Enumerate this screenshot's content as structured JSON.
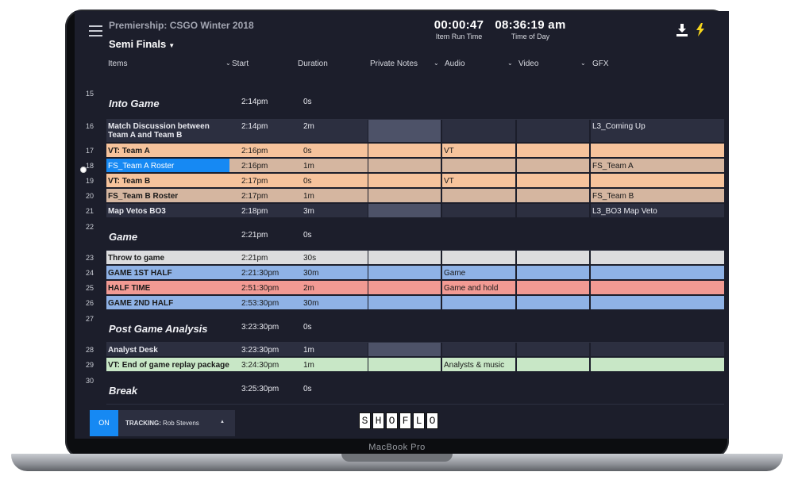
{
  "device_label": "MacBook Pro",
  "header": {
    "show_title": "Premiership: CSGO Winter 2018",
    "rundown_title": "Semi Finals",
    "item_run_time": "00:00:47",
    "item_run_time_label": "Item Run Time",
    "time_of_day": "08:36:19 am",
    "time_of_day_label": "Time of Day"
  },
  "columns": [
    "Items",
    "Start",
    "Duration",
    "Private Notes",
    "Audio",
    "Video",
    "GFX"
  ],
  "colors": {
    "bg": "#1c1e2b",
    "row_dark": "#2c2f40",
    "notes_dark": "#4d5268",
    "orange": "#f6c39c",
    "tan": "#d5b6a0",
    "grey": "#dcdcde",
    "blue": "#8fb2e6",
    "red": "#f29a93",
    "green": "#c8e7c6",
    "selected": "#1689f3"
  },
  "rows": [
    {
      "num": "15",
      "type": "header",
      "name": "Into Game",
      "start": "2:14pm",
      "duration": "0s"
    },
    {
      "num": "16",
      "type": "dark",
      "name": "Match Discussion between",
      "name2": "Team A and Team B",
      "start": "2:14pm",
      "duration": "2m",
      "notes": "",
      "audio": "",
      "video": "",
      "gfx": "L3_Coming Up"
    },
    {
      "num": "17",
      "type": "orange",
      "name": "VT: Team A",
      "start": "2:16pm",
      "duration": "0s",
      "notes": "",
      "audio": "VT",
      "video": "",
      "gfx": ""
    },
    {
      "num": "18",
      "type": "tan",
      "name": "FS_Team A Roster",
      "start": "2:16pm",
      "duration": "1m",
      "notes": "",
      "audio": "",
      "video": "",
      "gfx": "FS_Team A",
      "selected": true
    },
    {
      "num": "19",
      "type": "orange",
      "name": "VT: Team B",
      "start": "2:17pm",
      "duration": "0s",
      "notes": "",
      "audio": "VT",
      "video": "",
      "gfx": ""
    },
    {
      "num": "20",
      "type": "tan",
      "name": "FS_Team B Roster",
      "start": "2:17pm",
      "duration": "1m",
      "notes": "",
      "audio": "",
      "video": "",
      "gfx": "FS_Team B"
    },
    {
      "num": "21",
      "type": "dark",
      "name": "Map Vetos BO3",
      "start": "2:18pm",
      "duration": "3m",
      "notes": "",
      "audio": "",
      "video": "",
      "gfx": "L3_BO3 Map Veto"
    },
    {
      "num": "22",
      "type": "header",
      "name": "Game",
      "start": "2:21pm",
      "duration": "0s"
    },
    {
      "num": "23",
      "type": "grey",
      "name": "Throw to game",
      "start": "2:21pm",
      "duration": "30s",
      "notes": "",
      "audio": "",
      "video": "",
      "gfx": ""
    },
    {
      "num": "24",
      "type": "blue",
      "name": "GAME 1ST HALF",
      "start": "2:21:30pm",
      "duration": "30m",
      "notes": "",
      "audio": "Game",
      "video": "",
      "gfx": ""
    },
    {
      "num": "25",
      "type": "red",
      "name": "HALF TIME",
      "start": "2:51:30pm",
      "duration": "2m",
      "notes": "",
      "audio": "Game and hold",
      "video": "",
      "gfx": ""
    },
    {
      "num": "26",
      "type": "blue",
      "name": "GAME 2ND HALF",
      "start": "2:53:30pm",
      "duration": "30m",
      "notes": "",
      "audio": "",
      "video": "",
      "gfx": ""
    },
    {
      "num": "27",
      "type": "header",
      "name": "Post Game Analysis",
      "start": "3:23:30pm",
      "duration": "0s"
    },
    {
      "num": "28",
      "type": "dark",
      "name": "Analyst Desk",
      "start": "3:23:30pm",
      "duration": "1m",
      "notes": "",
      "audio": "",
      "video": "",
      "gfx": ""
    },
    {
      "num": "29",
      "type": "green",
      "name": "VT: End of game replay package",
      "start": "3:24:30pm",
      "duration": "1m",
      "notes": "",
      "audio": "Analysts & music",
      "video": "",
      "gfx": ""
    },
    {
      "num": "30",
      "type": "header",
      "name": "Break",
      "start": "3:25:30pm",
      "duration": "0s"
    }
  ],
  "footer": {
    "toggle_label": "ON",
    "tracking_label": "TRACKING:",
    "tracking_user": "Rob Stevens",
    "logo_letters": [
      "S",
      "H",
      "O",
      "F",
      "L",
      "O"
    ]
  }
}
